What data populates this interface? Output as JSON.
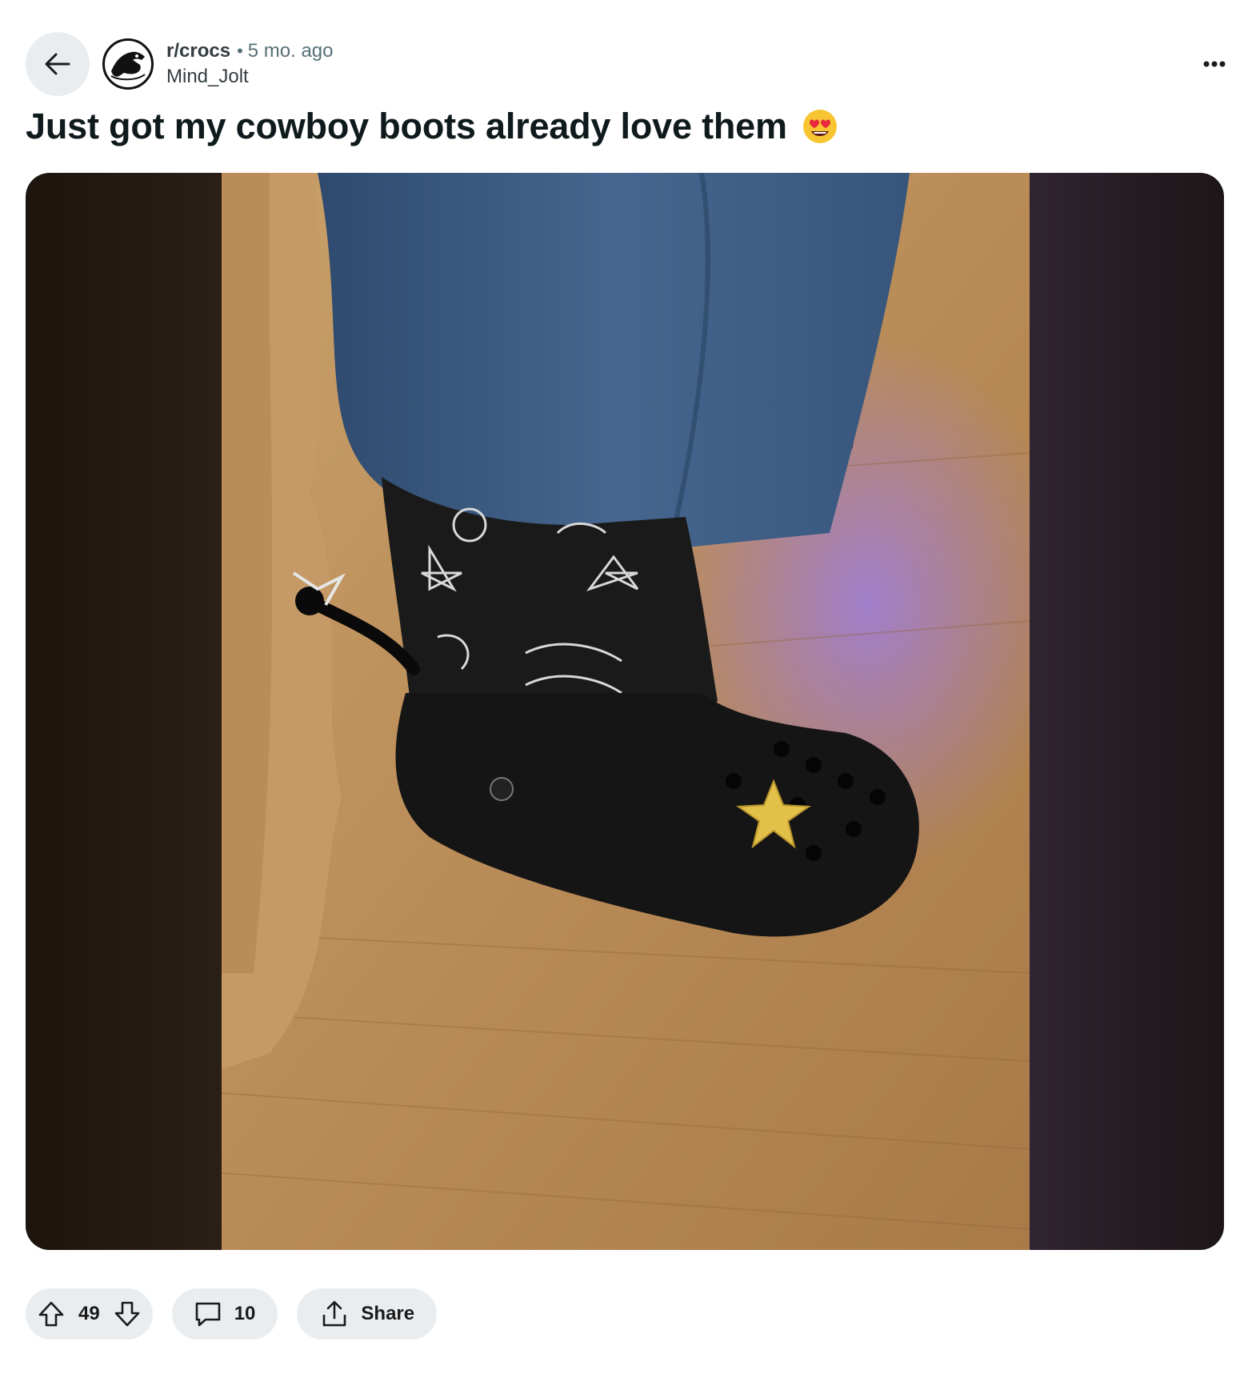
{
  "post": {
    "subreddit": "r/crocs",
    "separator": "•",
    "age": "5 mo. ago",
    "author": "Mind_Jolt",
    "title": "Just got my cowboy boots already love them",
    "title_emoji": "smiling-face-with-heart-eyes-emoji"
  },
  "actions": {
    "score": "49",
    "comments": "10",
    "share_label": "Share"
  },
  "icons": {
    "back": "arrow-left-icon",
    "more": "more-options-icon",
    "upvote": "upvote-arrow-icon",
    "downvote": "downvote-arrow-icon",
    "comment": "comment-bubble-icon",
    "share": "share-icon"
  },
  "colors": {
    "pill_background": "#eaedef",
    "meta_text": "#576f76",
    "title_text": "#0f1a1c"
  }
}
